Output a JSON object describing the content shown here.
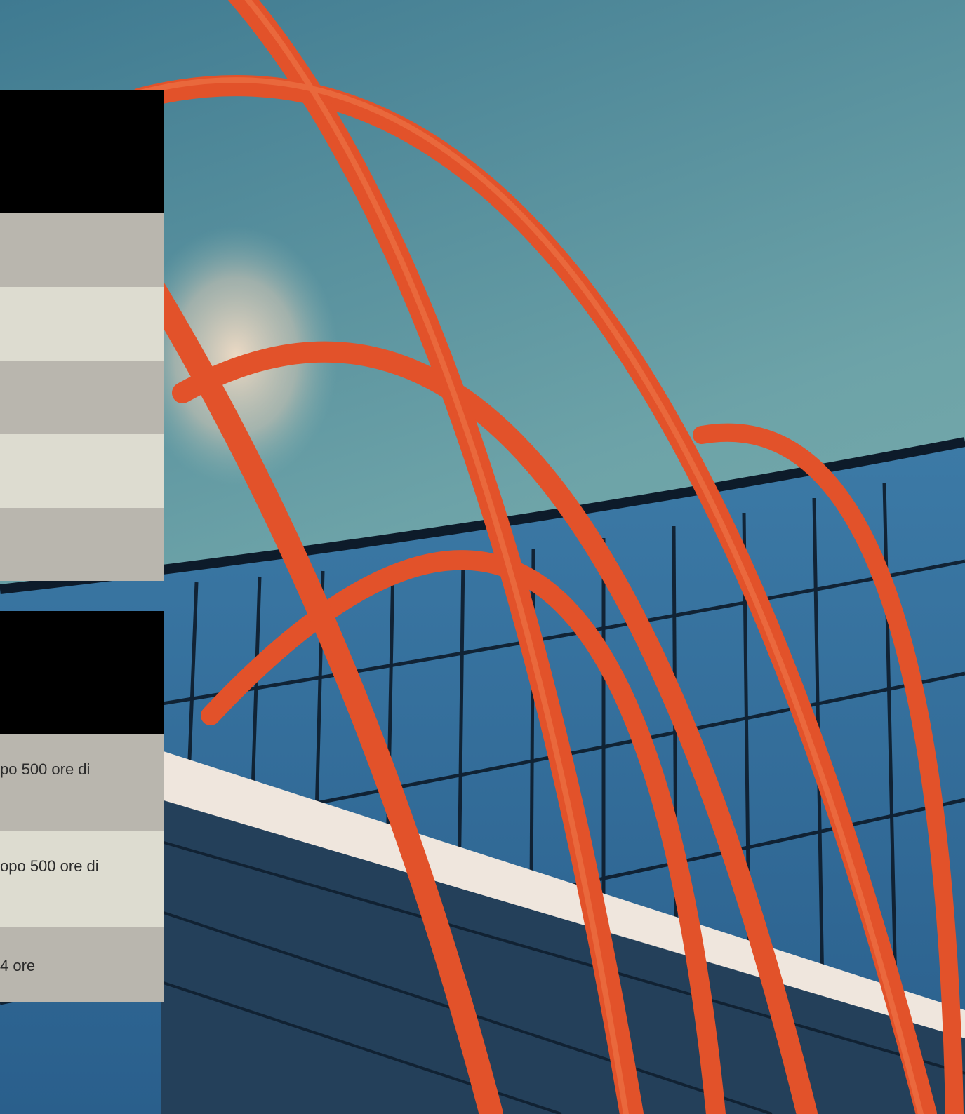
{
  "table_top": {
    "rows": [
      "",
      "",
      "",
      "",
      ""
    ]
  },
  "table_bottom": {
    "rows": [
      {
        "text": "po 500 ore di"
      },
      {
        "text": "opo 500 ore di"
      },
      {
        "text": "4 ore"
      }
    ]
  },
  "colors": {
    "header": "#000000",
    "row_gray": "#b9b6ae",
    "row_cream": "#dddcd0",
    "sky": "#4f8696",
    "arches": "#e2522a"
  }
}
